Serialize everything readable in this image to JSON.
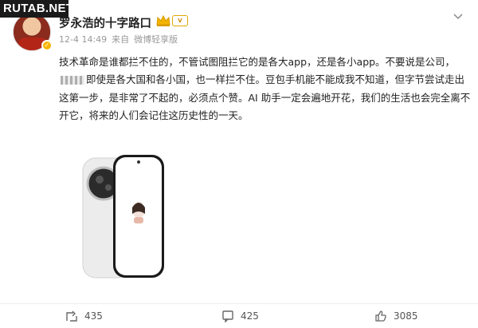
{
  "watermark": "RUTAB.NET",
  "post": {
    "author": "罗永浩的十字路口",
    "timestamp": "12-4 14:49",
    "source_prefix": "来自",
    "source": "微博轻享版",
    "body_part1": "技术革命是谁都拦不住的，不管试图阻拦它的是各大app，还是各小app。不要说是公司，",
    "body_part2": "即使是各大国和各小国，也一样拦不住。豆包手机能不能成我不知道，但字节尝试走出这第一步，是非常了不起的，必须点个赞。AI 助手一定会遍地开花，我们的生活也会完全离不开它，将来的人们会记住这历史性的一天。"
  },
  "actions": {
    "repost_count": "435",
    "comment_count": "425",
    "like_count": "3085"
  },
  "icons": {
    "more": "chevron-down-icon",
    "repost": "repost-icon",
    "comment": "comment-icon",
    "like": "like-icon",
    "verify": "verified-badge-icon",
    "crown": "crown-icon"
  },
  "colors": {
    "verify": "#f7b500",
    "meta": "#999999",
    "text": "#222222"
  }
}
